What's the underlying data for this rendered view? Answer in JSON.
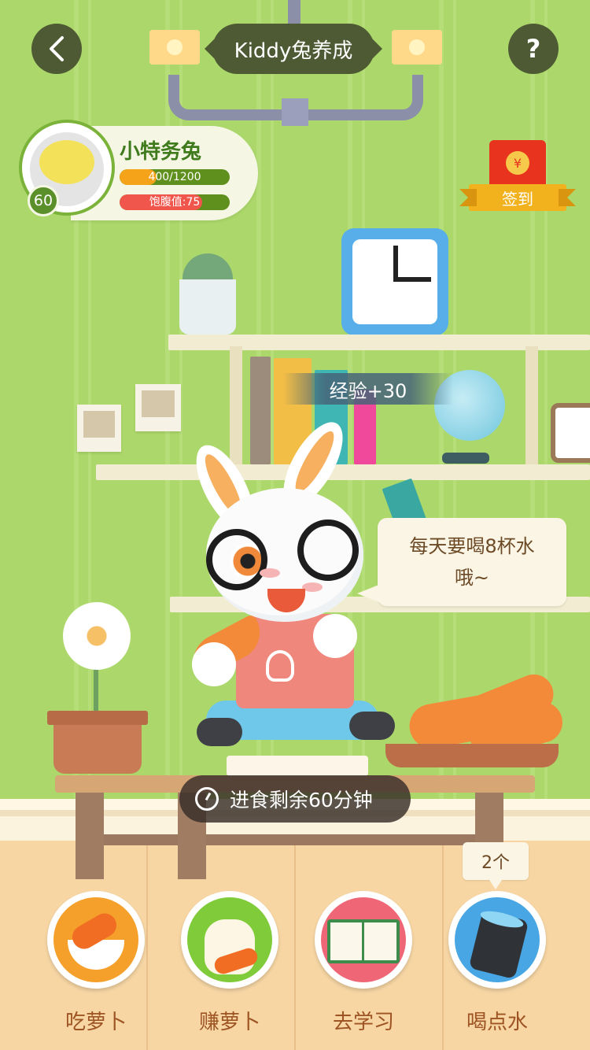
{
  "header": {
    "title": "Kiddy兔养成",
    "back_icon": "‹",
    "help_icon": "?"
  },
  "profile": {
    "nickname": "小特务兔",
    "level": "60",
    "experience": {
      "label": "400/1200",
      "value": 400,
      "max": 1200
    },
    "satiety": {
      "label": "饱腹值:75",
      "value": 75,
      "max": 100
    }
  },
  "checkin": {
    "coin_symbol": "¥",
    "label": "签到"
  },
  "floating_text": "经验+30",
  "speech_bubble": {
    "line1": "每天要喝8杯水",
    "line2": "哦~"
  },
  "timer": {
    "text": "进食剩余60分钟"
  },
  "water_count": "2个",
  "actions": [
    {
      "label": "吃萝卜",
      "icon": "carrot-bowl-icon",
      "color": "#f5a02b"
    },
    {
      "label": "赚萝卜",
      "icon": "carrot-bag-icon",
      "color": "#7fcb3a"
    },
    {
      "label": "去学习",
      "icon": "book-icon",
      "color": "#ef6777"
    },
    {
      "label": "喝点水",
      "icon": "water-mug-icon",
      "color": "#48a6e4"
    }
  ],
  "colors": {
    "header_bg": "#4e5a34",
    "exp_bar": "#f5a41a",
    "satiety_bar": "#f0564c",
    "level_badge": "#5a8f2a",
    "action_label": "#9d5422"
  }
}
